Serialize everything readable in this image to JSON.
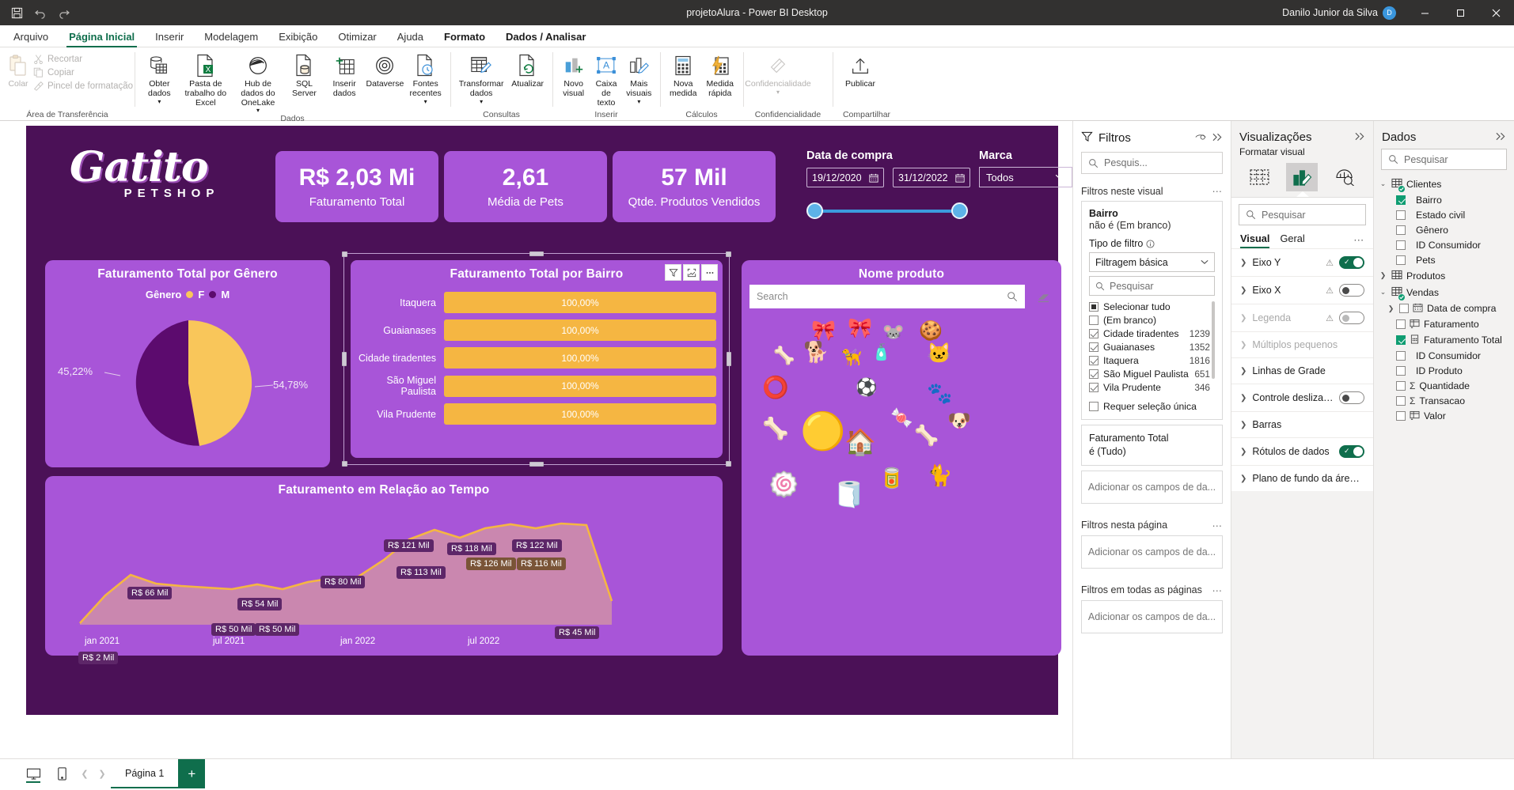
{
  "titlebar": {
    "doc_title": "projetoAlura - Power BI Desktop",
    "user": "Danilo Junior da Silva",
    "avatar_initials": "D",
    "save_icon": "save-icon",
    "undo_icon": "undo-icon",
    "redo_icon": "redo-icon",
    "minimize": "—",
    "maximize": "□",
    "close": "✕"
  },
  "ribbon_tabs": [
    {
      "label": "Arquivo",
      "active": false
    },
    {
      "label": "Página Inicial",
      "active": true
    },
    {
      "label": "Inserir",
      "active": false
    },
    {
      "label": "Modelagem",
      "active": false
    },
    {
      "label": "Exibição",
      "active": false
    },
    {
      "label": "Otimizar",
      "active": false
    },
    {
      "label": "Ajuda",
      "active": false
    },
    {
      "label": "Formato",
      "active": false,
      "contextual": true
    },
    {
      "label": "Dados / Analisar",
      "active": false,
      "contextual": true
    }
  ],
  "ribbon": {
    "clipboard": {
      "group_label": "Área de Transferência",
      "paste_label": "Colar",
      "items": [
        {
          "label": "Recortar",
          "icon": "scissors-icon"
        },
        {
          "label": "Copiar",
          "icon": "copy-icon"
        },
        {
          "label": "Pincel de formatação",
          "icon": "format-painter-icon"
        }
      ]
    },
    "dados": {
      "group_label": "Dados",
      "items": [
        {
          "label": "Obter dados",
          "icon": "get-data-icon",
          "caret": true
        },
        {
          "label": "Pasta de trabalho do Excel",
          "icon": "excel-icon"
        },
        {
          "label": "Hub de dados do OneLake",
          "icon": "onelake-icon",
          "caret": true
        },
        {
          "label": "SQL Server",
          "icon": "sql-server-icon"
        },
        {
          "label": "Inserir dados",
          "icon": "enter-data-icon"
        },
        {
          "label": "Dataverse",
          "icon": "dataverse-icon"
        },
        {
          "label": "Fontes recentes",
          "icon": "recent-sources-icon",
          "caret": true
        }
      ]
    },
    "consultas": {
      "group_label": "Consultas",
      "items": [
        {
          "label": "Transformar dados",
          "icon": "transform-data-icon",
          "caret": true
        },
        {
          "label": "Atualizar",
          "icon": "refresh-icon"
        }
      ]
    },
    "inserir": {
      "group_label": "Inserir",
      "items": [
        {
          "label": "Novo visual",
          "icon": "new-visual-icon"
        },
        {
          "label": "Caixa de texto",
          "icon": "text-box-icon"
        },
        {
          "label": "Mais visuais",
          "icon": "more-visuals-icon",
          "caret": true
        }
      ]
    },
    "calculos": {
      "group_label": "Cálculos",
      "items": [
        {
          "label": "Nova medida",
          "icon": "new-measure-icon"
        },
        {
          "label": "Medida rápida",
          "icon": "quick-measure-icon"
        }
      ]
    },
    "confidencialidade": {
      "group_label": "Confidencialidade",
      "items": [
        {
          "label": "Confidencialidade",
          "icon": "sensitivity-icon",
          "caret": true,
          "disabled": true
        }
      ]
    },
    "compartilhar": {
      "group_label": "Compartilhar",
      "items": [
        {
          "label": "Publicar",
          "icon": "publish-icon"
        }
      ]
    }
  },
  "report": {
    "logo": {
      "name": "Gatito",
      "sub": "PETSHOP"
    },
    "kpis": [
      {
        "value": "R$ 2,03 Mi",
        "label": "Faturamento Total"
      },
      {
        "value": "2,61",
        "label": "Média de Pets"
      },
      {
        "value": "57 Mil",
        "label": "Qtde. Produtos Vendidos"
      }
    ],
    "date_slicer": {
      "label": "Data de compra",
      "start": "19/12/2020",
      "end": "31/12/2022",
      "calendar_icon": "calendar-icon"
    },
    "marca_slicer": {
      "label": "Marca",
      "value": "Todos",
      "caret_icon": "chevron-down-icon"
    },
    "gender_chart": {
      "title": "Faturamento Total por Gênero",
      "legend_title": "Gênero"
    },
    "bairro_chart": {
      "title": "Faturamento Total por Bairro",
      "header_buttons": [
        "filter-icon",
        "focus-mode-icon",
        "more-options-icon"
      ]
    },
    "product_visual": {
      "title": "Nome produto",
      "search_placeholder": "Search",
      "search_icon": "search-icon",
      "eraser_icon": "eraser-icon"
    },
    "time_chart": {
      "title": "Faturamento em Relação ao Tempo"
    }
  },
  "chart_data": [
    {
      "type": "pie",
      "title": "Faturamento Total por Gênero",
      "legend_title": "Gênero",
      "legend_position": "top",
      "slices": [
        {
          "name": "F",
          "value": 54.78,
          "label": "54,78%",
          "color": "#f9c65a"
        },
        {
          "name": "M",
          "value": 45.22,
          "label": "45,22%",
          "color": "#5c0b6e"
        }
      ]
    },
    {
      "type": "bar",
      "title": "Faturamento Total por Bairro",
      "orientation": "horizontal",
      "xlabel": "",
      "ylabel": "",
      "grid": false,
      "bar_color": "#f5b642",
      "categories": [
        "Itaquera",
        "Guaianases",
        "Cidade tiradentes",
        "São Miguel Paulista",
        "Vila Prudente"
      ],
      "values": [
        100.0,
        100.0,
        100.0,
        100.0,
        100.0
      ],
      "value_labels": [
        "100,00%",
        "100,00%",
        "100,00%",
        "100,00%",
        "100,00%"
      ]
    },
    {
      "type": "area",
      "title": "Faturamento em Relação ao Tempo",
      "xlabel": "",
      "ylabel": "",
      "grid": false,
      "line_color": "#f5b642",
      "tick_labels": [
        "jan 2021",
        "jul 2021",
        "jan 2022",
        "jul 2022"
      ],
      "points": [
        {
          "x": 0,
          "label": "R$ 2 Mil",
          "value": 2
        },
        {
          "x": 1,
          "label": "",
          "value": 38
        },
        {
          "x": 2,
          "label": "R$ 66 Mil",
          "value": 66
        },
        {
          "x": 3,
          "label": "",
          "value": 58
        },
        {
          "x": 4,
          "label": "",
          "value": 55
        },
        {
          "x": 5,
          "label": "",
          "value": 52
        },
        {
          "x": 6,
          "label": "R$ 50 Mil",
          "value": 50
        },
        {
          "x": 7,
          "label": "R$ 54 Mil",
          "value": 54
        },
        {
          "x": 8,
          "label": "R$ 50 Mil",
          "value": 50
        },
        {
          "x": 9,
          "label": "",
          "value": 56
        },
        {
          "x": 10,
          "label": "",
          "value": 60
        },
        {
          "x": 11,
          "label": "",
          "value": 61
        },
        {
          "x": 12,
          "label": "R$ 80 Mil",
          "value": 80
        },
        {
          "x": 13,
          "label": "",
          "value": 105
        },
        {
          "x": 14,
          "label": "R$ 121 Mil",
          "value": 121
        },
        {
          "x": 15,
          "label": "R$ 113 Mil",
          "value": 113
        },
        {
          "x": 16,
          "label": "R$ 118 Mil",
          "value": 118
        },
        {
          "x": 17,
          "label": "R$ 126 Mil",
          "value": 126
        },
        {
          "x": 18,
          "label": "R$ 116 Mil",
          "value": 116
        },
        {
          "x": 19,
          "label": "R$ 122 Mil",
          "value": 122
        },
        {
          "x": 20,
          "label": "",
          "value": 120
        },
        {
          "x": 21,
          "label": "R$ 45 Mil",
          "value": 45
        }
      ]
    }
  ],
  "filters_pane": {
    "title": "Filtros",
    "icon": "filter-icon",
    "eye_icon": "eye-icon",
    "collapse_icon": "chevron-right-double-icon",
    "search_placeholder": "Pesquis...",
    "search_icon": "search-icon",
    "visual_section": "Filtros neste visual",
    "page_section": "Filtros nesta página",
    "all_pages_section": "Filtros em todas as páginas",
    "bairro_filter": {
      "name": "Bairro",
      "condition": "não é (Em branco)",
      "type_label": "Tipo de filtro",
      "info_icon": "info-icon",
      "type_value": "Filtragem básica",
      "list_search_placeholder": "Pesquisar",
      "items": [
        {
          "label": "Selecionar tudo",
          "state": "partial",
          "count": ""
        },
        {
          "label": "(Em branco)",
          "state": "unchecked",
          "count": ""
        },
        {
          "label": "Cidade tiradentes",
          "state": "checked",
          "count": "1239"
        },
        {
          "label": "Guaianases",
          "state": "checked",
          "count": "1352"
        },
        {
          "label": "Itaquera",
          "state": "checked",
          "count": "1816"
        },
        {
          "label": "São Miguel Paulista",
          "state": "checked",
          "count": "651"
        },
        {
          "label": "Vila Prudente",
          "state": "checked",
          "count": "346"
        }
      ],
      "require_single": "Requer seleção única"
    },
    "faturamento_filter": {
      "name": "Faturamento Total",
      "condition": "é (Tudo)"
    },
    "add_fields_placeholder": "Adicionar os campos de da...",
    "more_icon": "more-options-icon"
  },
  "viz_pane": {
    "title": "Visualizações",
    "collapse_icon": "chevron-right-double-icon",
    "subtitle": "Formatar visual",
    "icons": [
      {
        "name": "build-visual-icon",
        "selected": false
      },
      {
        "name": "format-visual-icon",
        "selected": true
      },
      {
        "name": "analytics-icon",
        "selected": false
      }
    ],
    "search_placeholder": "Pesquisar",
    "search_icon": "search-icon",
    "tabs": [
      {
        "label": "Visual",
        "active": true
      },
      {
        "label": "Geral",
        "active": false
      }
    ],
    "more_icon": "more-options-icon",
    "rows": [
      {
        "label": "Eixo Y",
        "warn": true,
        "toggle": "on",
        "dim": false
      },
      {
        "label": "Eixo X",
        "warn": true,
        "toggle": "off",
        "dim": false
      },
      {
        "label": "Legenda",
        "warn": true,
        "toggle": "off",
        "dim": true
      },
      {
        "label": "Múltiplos pequenos",
        "warn": false,
        "toggle": "none",
        "dim": true
      },
      {
        "label": "Linhas de Grade",
        "warn": false,
        "toggle": "none",
        "dim": false
      },
      {
        "label": "Controle deslizan...",
        "warn": false,
        "toggle": "off",
        "dim": false
      },
      {
        "label": "Barras",
        "warn": false,
        "toggle": "none",
        "dim": false
      },
      {
        "label": "Rótulos de dados",
        "warn": false,
        "toggle": "on",
        "dim": false
      },
      {
        "label": "Plano de fundo da área ...",
        "warn": false,
        "toggle": "none",
        "dim": false
      }
    ]
  },
  "data_pane": {
    "title": "Dados",
    "collapse_icon": "chevron-right-double-icon",
    "search_placeholder": "Pesquisar",
    "search_icon": "search-icon",
    "tables": [
      {
        "name": "Clientes",
        "expanded": true,
        "active": true,
        "fields": [
          {
            "label": "Bairro",
            "checked": true,
            "icon": ""
          },
          {
            "label": "Estado civil",
            "checked": false,
            "icon": ""
          },
          {
            "label": "Gênero",
            "checked": false,
            "icon": ""
          },
          {
            "label": "ID Consumidor",
            "checked": false,
            "icon": ""
          },
          {
            "label": "Pets",
            "checked": false,
            "icon": ""
          }
        ]
      },
      {
        "name": "Produtos",
        "expanded": false,
        "active": false,
        "fields": []
      },
      {
        "name": "Vendas",
        "expanded": true,
        "active": true,
        "fields": [
          {
            "label": "Data de compra",
            "checked": false,
            "icon": "calendar-icon",
            "expandable": true
          },
          {
            "label": "Faturamento",
            "checked": false,
            "icon": "measure-icon"
          },
          {
            "label": "Faturamento Total",
            "checked": true,
            "icon": "calc-icon"
          },
          {
            "label": "ID Consumidor",
            "checked": false,
            "icon": ""
          },
          {
            "label": "ID Produto",
            "checked": false,
            "icon": ""
          },
          {
            "label": "Quantidade",
            "checked": false,
            "icon": "sigma-icon"
          },
          {
            "label": "Transacao",
            "checked": false,
            "icon": "sigma-icon"
          },
          {
            "label": "Valor",
            "checked": false,
            "icon": "measure-icon"
          }
        ]
      }
    ]
  },
  "statusbar": {
    "desktop_view_icon": "desktop-view-icon",
    "mobile_view_icon": "mobile-view-icon",
    "prev_icon": "chevron-left-icon",
    "next_icon": "chevron-right-icon",
    "page_tab": "Página 1",
    "add_page_label": "+"
  },
  "colors": {
    "canvas_bg": "#4b1157",
    "card_bg": "#a855d8",
    "accent_orange": "#f5b642",
    "accent_purple": "#5c0b6e",
    "brand_green": "#0f6e4c"
  }
}
